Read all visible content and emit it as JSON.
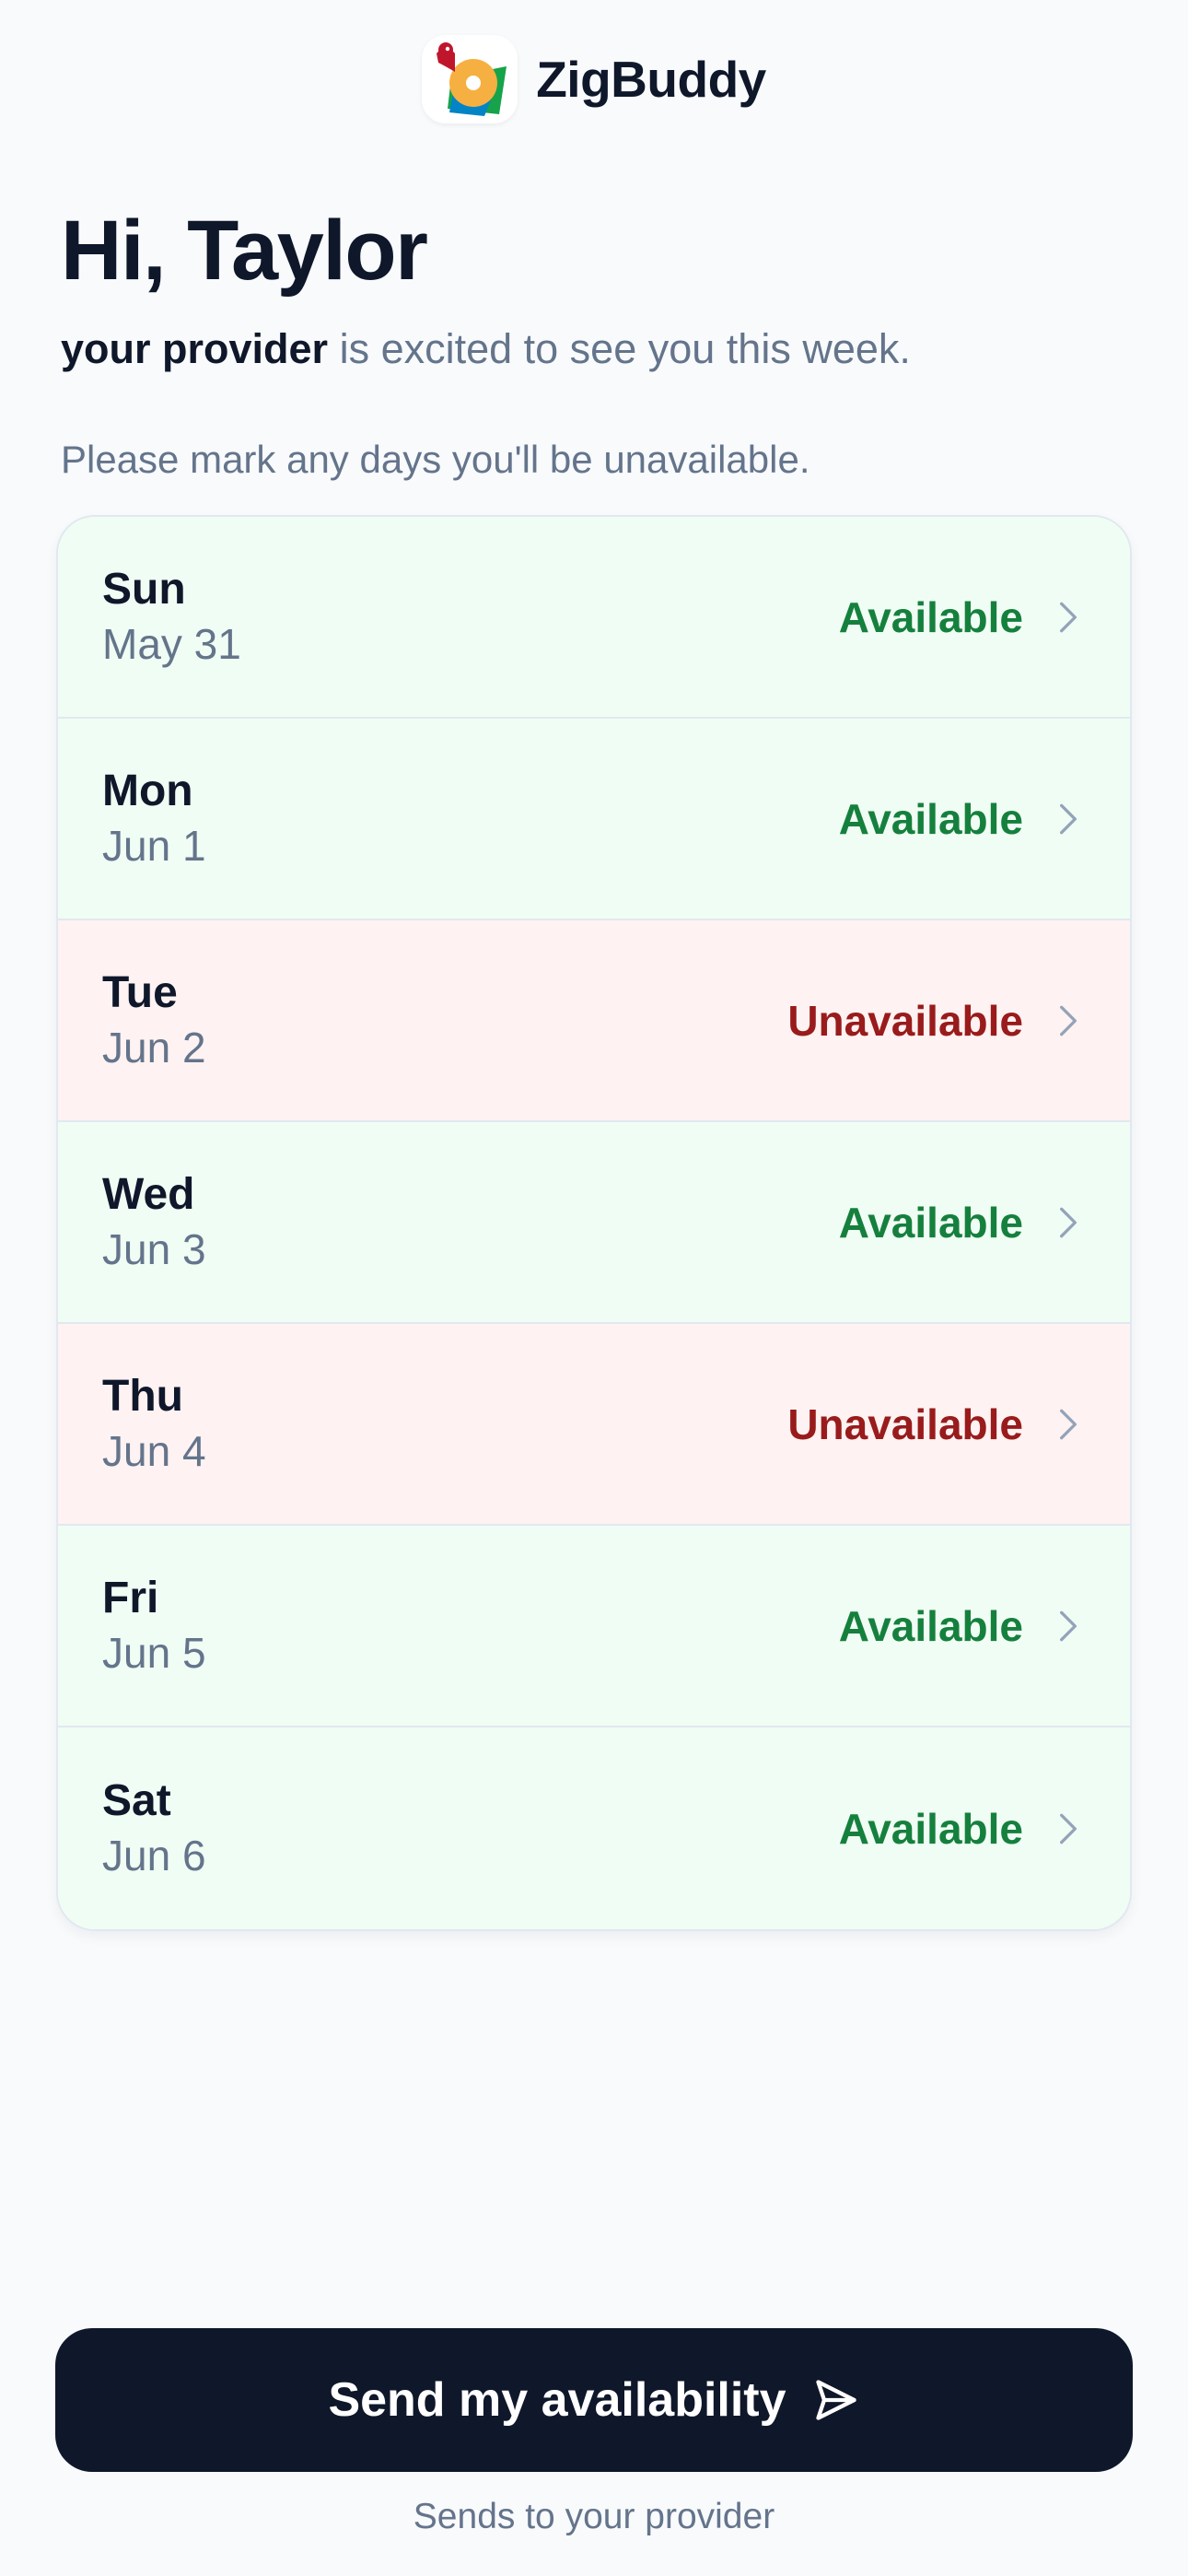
{
  "brand": {
    "name": "ZigBuddy",
    "logo_icon": "zigbuddy-bird-logo"
  },
  "greeting": {
    "title": "Hi, Taylor",
    "provider": "your provider",
    "message_rest": " is excited to see you this week."
  },
  "instructions": "Please mark any days you'll be unavailable.",
  "days": [
    {
      "day": "Sun",
      "date": "May 31",
      "status": "Available",
      "state": "available"
    },
    {
      "day": "Mon",
      "date": "Jun 1",
      "status": "Available",
      "state": "available"
    },
    {
      "day": "Tue",
      "date": "Jun 2",
      "status": "Unavailable",
      "state": "unavailable"
    },
    {
      "day": "Wed",
      "date": "Jun 3",
      "status": "Available",
      "state": "available"
    },
    {
      "day": "Thu",
      "date": "Jun 4",
      "status": "Unavailable",
      "state": "unavailable"
    },
    {
      "day": "Fri",
      "date": "Jun 5",
      "status": "Available",
      "state": "available"
    },
    {
      "day": "Sat",
      "date": "Jun 6",
      "status": "Available",
      "state": "available"
    }
  ],
  "send_button": {
    "label": "Send my availability",
    "icon": "send-icon"
  },
  "footnote": "Sends to your provider",
  "colors": {
    "background": "#f8fafc",
    "available_bg": "#f0fdf4",
    "available_text": "#15803d",
    "unavailable_bg": "#fef2f2",
    "unavailable_text": "#991b1b",
    "button_bg": "#0f172a"
  }
}
